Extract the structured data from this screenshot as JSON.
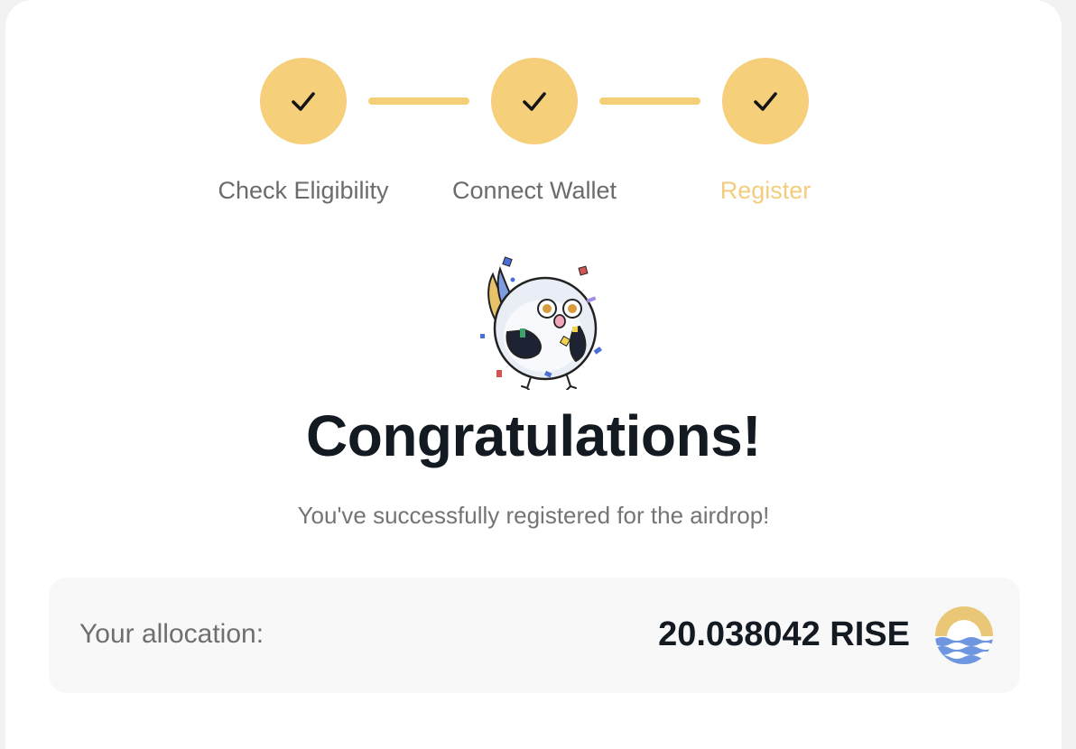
{
  "stepper": {
    "steps": [
      {
        "label": "Check Eligibility",
        "status": "complete",
        "icon": "check-icon"
      },
      {
        "label": "Connect Wallet",
        "status": "complete",
        "icon": "check-icon"
      },
      {
        "label": "Register",
        "status": "active",
        "icon": "check-icon"
      }
    ]
  },
  "result": {
    "title": "Congratulations!",
    "message": "You've successfully registered for the airdrop!"
  },
  "allocation": {
    "label": "Your allocation:",
    "amount": "20.038042 RISE",
    "token_icon": "rise-token-icon"
  },
  "colors": {
    "accent": "#f6cf7b",
    "active_label": "#f3cd7e",
    "title": "#141a22",
    "muted_text": "#747474",
    "token_blue": "#6f96e0",
    "token_gold": "#e9c777"
  }
}
